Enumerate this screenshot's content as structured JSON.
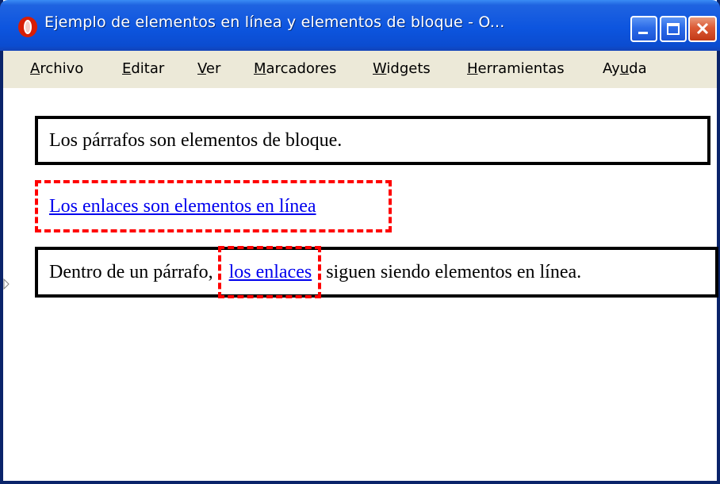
{
  "window": {
    "title": "Ejemplo de elementos en línea y elementos de bloque - O...",
    "app_icon": "opera-icon",
    "controls": {
      "minimize_icon": "minimize-icon",
      "maximize_icon": "maximize-icon",
      "close_icon": "close-icon"
    }
  },
  "menubar": {
    "items": [
      {
        "accel": "A",
        "rest": "rchivo"
      },
      {
        "accel": "E",
        "rest": "ditar"
      },
      {
        "accel": "V",
        "rest": "er"
      },
      {
        "accel": "M",
        "rest": "arcadores"
      },
      {
        "accel": "W",
        "pre": "",
        "rest": "idgets"
      },
      {
        "accel": "H",
        "rest": "erramientas"
      },
      {
        "pre": "Ay",
        "accel": "u",
        "rest": "da"
      }
    ]
  },
  "page": {
    "paragraph1": "Los párrafos son elementos de bloque.",
    "link_block": "Los enlaces son elementos en línea",
    "paragraph3_before": "Dentro de un párrafo,",
    "paragraph3_link": "los enlaces",
    "paragraph3_after": "siguen siendo elementos en línea."
  },
  "colors": {
    "titlebar": "#0d55df",
    "menubar": "#ece9d8",
    "link": "#0000ee",
    "dashed_border": "#ff0000",
    "solid_border": "#000000"
  }
}
